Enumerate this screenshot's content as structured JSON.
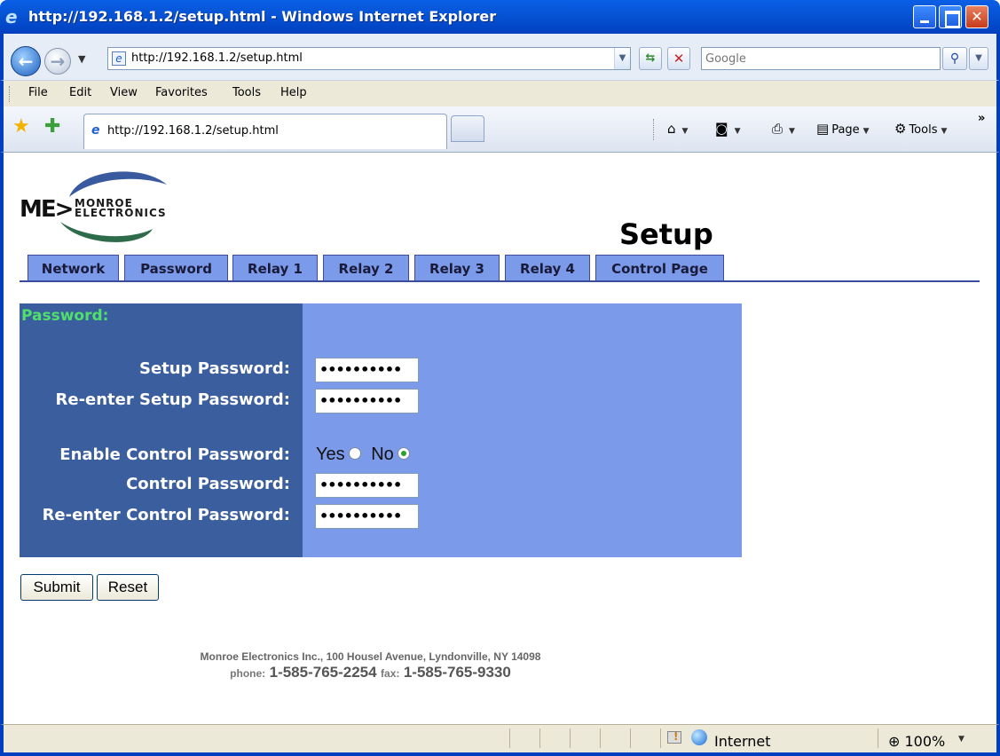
{
  "window": {
    "title": "http://192.168.1.2/setup.html - Windows Internet Explorer"
  },
  "address_bar": {
    "url": "http://192.168.1.2/setup.html",
    "search_placeholder": "Google"
  },
  "menu": {
    "items": [
      "File",
      "Edit",
      "View",
      "Favorites",
      "Tools",
      "Help"
    ]
  },
  "browser_tab": {
    "title": "http://192.168.1.2/setup.html"
  },
  "command_bar": {
    "page_label": "Page",
    "tools_label": "Tools"
  },
  "page": {
    "logo_line1": "MONROE",
    "logo_line2": "ELECTRONICS",
    "heading": "Setup",
    "tabs": [
      "Network",
      "Password",
      "Relay 1",
      "Relay 2",
      "Relay 3",
      "Relay 4",
      "Control Page"
    ],
    "section_title": "Password:",
    "form": {
      "setup_password_label": "Setup Password:",
      "reenter_setup_password_label": "Re-enter Setup Password:",
      "enable_control_password_label": "Enable Control Password:",
      "control_password_label": "Control Password:",
      "reenter_control_password_label": "Re-enter Control Password:",
      "setup_password_value": "••••••••••",
      "reenter_setup_password_value": "••••••••••",
      "control_password_value": "••••••••••",
      "reenter_control_password_value": "••••••••••",
      "yes_label": "Yes",
      "no_label": "No",
      "enable_control_password_selected": "No"
    },
    "buttons": {
      "submit": "Submit",
      "reset": "Reset"
    },
    "footer": {
      "address": "Monroe Electronics Inc., 100 Housel Avenue, Lyndonville, NY 14098",
      "phone_label": "phone:",
      "phone": "1-585-765-2254",
      "fax_label": "fax:",
      "fax": "1-585-765-9330"
    }
  },
  "status_bar": {
    "zone": "Internet",
    "zoom": "100%"
  },
  "colors": {
    "titlebar": "#0754d6",
    "tab_bg": "#7b9ae9",
    "form_left_bg": "#3b5e9e",
    "form_right_bg": "#7b9ae9",
    "section_title": "#4ee06a"
  }
}
